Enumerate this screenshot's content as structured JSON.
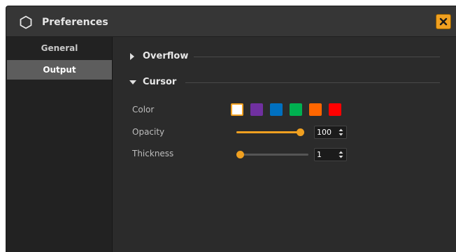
{
  "window": {
    "title": "Preferences",
    "title_icon": "hexagon-icon",
    "close_icon": "close-icon"
  },
  "sidebar": {
    "items": [
      {
        "label": "General",
        "active": false
      },
      {
        "label": "Output",
        "active": true
      }
    ]
  },
  "sections": {
    "overflow": {
      "label": "Overflow",
      "expanded": false,
      "icon": "triangle-right-icon"
    },
    "cursor": {
      "label": "Cursor",
      "expanded": true,
      "icon": "triangle-down-icon"
    }
  },
  "cursor": {
    "color": {
      "label": "Color",
      "selected_index": 0,
      "swatches": [
        "#ffffff",
        "#7030a0",
        "#0070c0",
        "#00b050",
        "#ff6600",
        "#ff0000"
      ]
    },
    "opacity": {
      "label": "Opacity",
      "value": "100",
      "fraction": 1.0
    },
    "thickness": {
      "label": "Thickness",
      "value": "1",
      "fraction": 0.0
    }
  },
  "colors": {
    "accent": "#f0a020",
    "background": "#2b2b2b",
    "sidebar": "#222222",
    "sidebar_active": "#5d5d5d"
  }
}
